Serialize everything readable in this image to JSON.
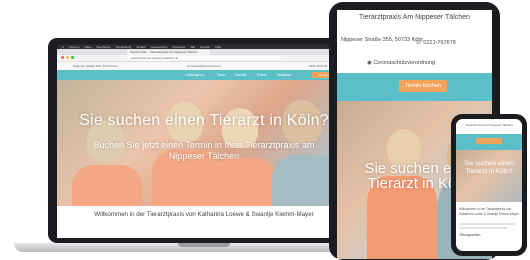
{
  "laptop": {
    "mac_menu": [
      "Chrome",
      "Datei",
      "Bearbeiten",
      "Darstellung",
      "Verlauf",
      "Lesezeichen",
      "Personen",
      "Tab",
      "Fenster",
      "Hilfe"
    ],
    "browser_tab": "Tierarzt Köln – Tierarztpraxis Am Nippeser Tälchen",
    "url": "www.tierarzt-am-nippeser-taelchen.de",
    "topbar": {
      "address": "Nippeser Straße 355, 50733 Köln",
      "notice": "Coronaschutzverordnung",
      "phone": "0221-767678"
    },
    "nav": [
      "Leistungen ▾",
      "Team",
      "Kontakt",
      "Praxis",
      "Notdienst"
    ],
    "nav_cta": "Termin buchen",
    "hero_title": "Sie suchen einen Tierarzt in Köln?",
    "hero_sub": "Buchen Sie jetzt einen Termin in Ihrer Tierarztpraxis am Nippeser Tälchen",
    "welcome": "Willkommen in der Tierarztpraxis von Katharina Loewe & Swantje Klemm-Mayer"
  },
  "tablet": {
    "title": "Tierarztpraxis Am Nippeser Tälchen",
    "address": "Nippeser Straße 355, 50733 Köln",
    "phone": "0221-767678",
    "corona": "Coronaschutzverordnung",
    "button": "Termin buchen",
    "hero_text": "Sie suchen einen Tierarzt in Köln?"
  },
  "phone": {
    "topbar": "Tierarztpraxis Am Nippeser Tälchen",
    "hero_text": "Sie suchen einen Tierarzt in Köln?",
    "welcome": "Willkommen in der Tierarztpraxis von Katharina Loewe & Swantje Klemm-Mayer",
    "footer_label": "Öffnungszeiten"
  },
  "colors": {
    "teal": "#5bbfc9",
    "orange": "#f4a35b",
    "device_frame": "#1b1c1f"
  }
}
